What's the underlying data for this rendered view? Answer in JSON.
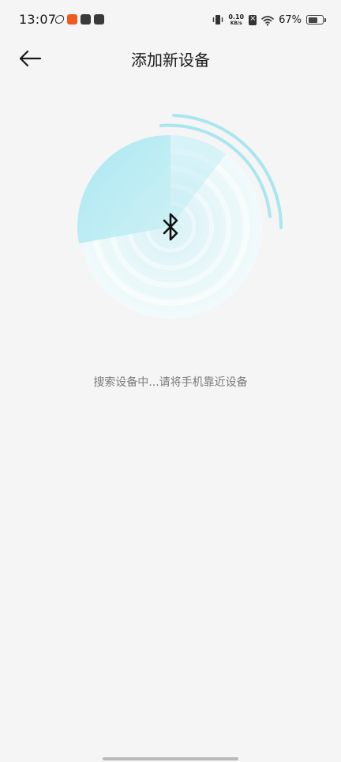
{
  "status_bar": {
    "time": "13:07",
    "net_speed_value": "0.10",
    "net_speed_unit": "KB/s",
    "battery_percent": "67%",
    "battery_level": 0.67,
    "icons": [
      "sync-icon",
      "app-notification-icon",
      "app-notification-icon",
      "mail-icon",
      "vibrate-icon",
      "sim-off-icon",
      "wifi-icon",
      "battery-icon"
    ]
  },
  "header": {
    "title": "添加新设备",
    "back_icon": "arrow-left-icon"
  },
  "scan": {
    "center_icon": "bluetooth-icon",
    "status_message": "搜索设备中...请将手机靠近设备",
    "colors": {
      "accent": "#a6e7f1",
      "arc": "#a9e6f0",
      "disc_light": "#eaf7fa"
    }
  }
}
